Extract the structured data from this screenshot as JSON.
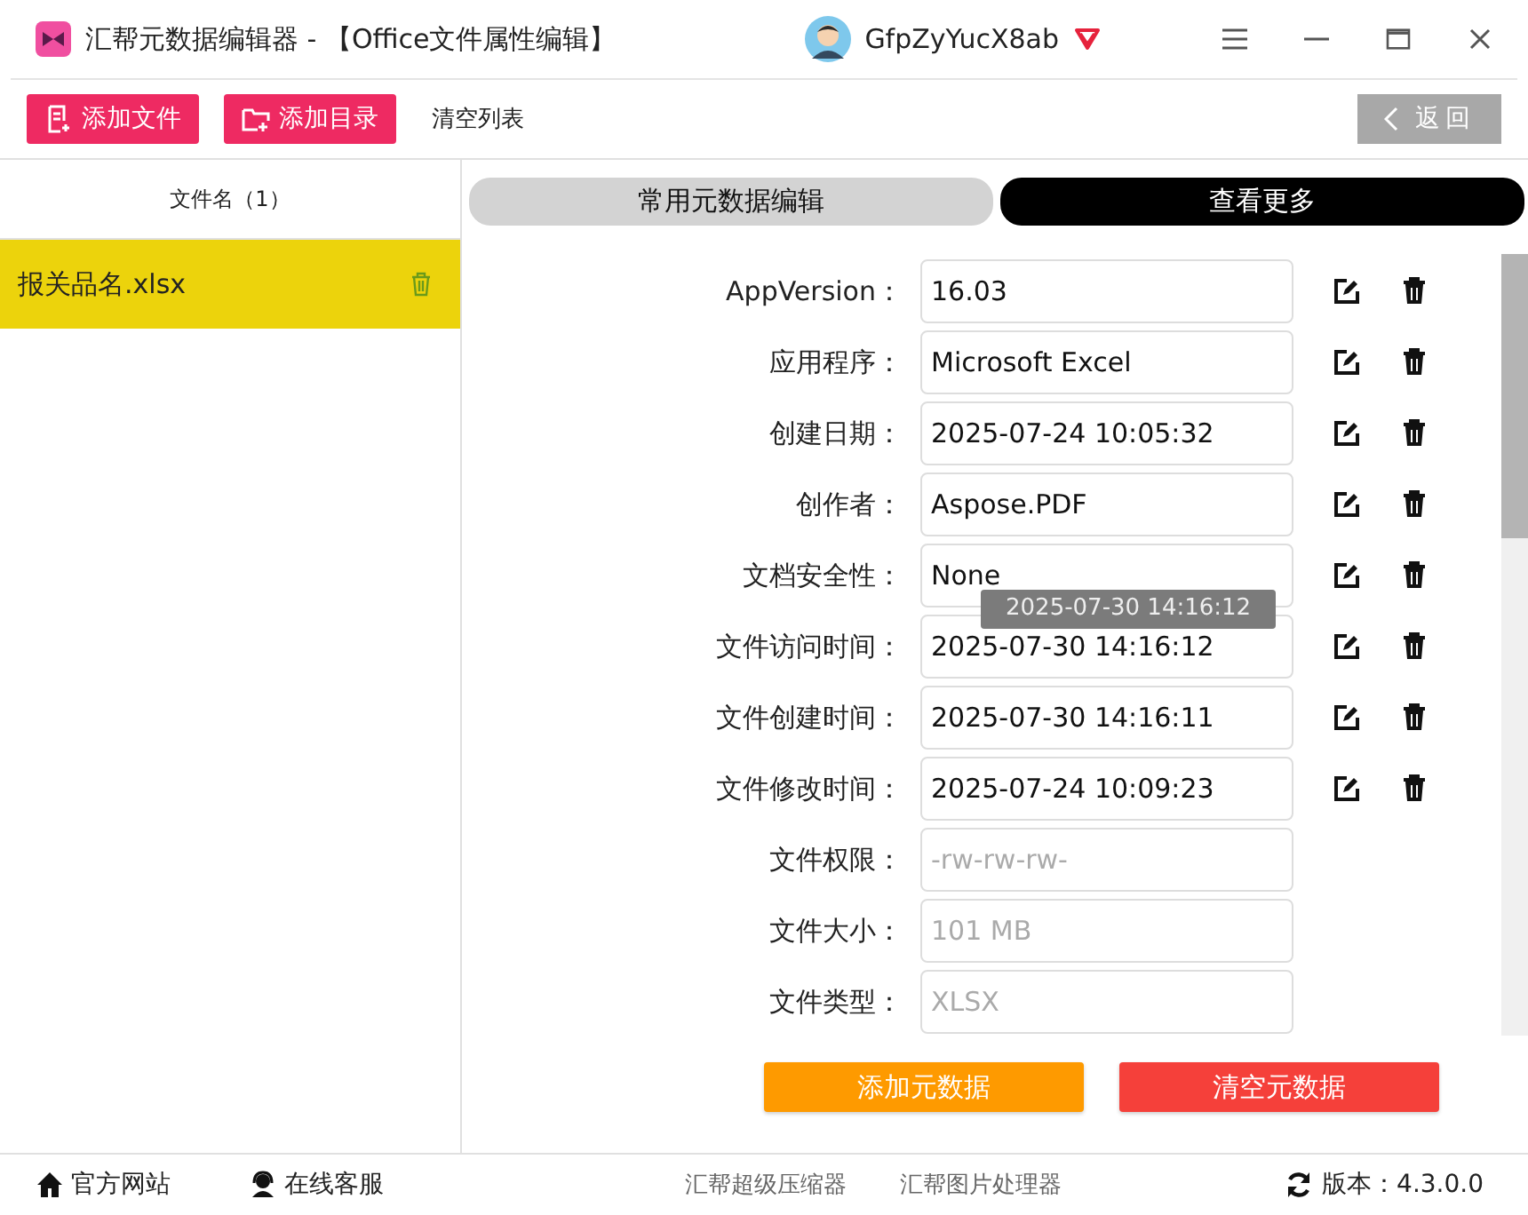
{
  "window": {
    "title": "汇帮元数据编辑器 - 【Office文件属性编辑】",
    "user": "GfpZyYucX8ab"
  },
  "toolbar": {
    "buttons": [
      {
        "label": "添加文件",
        "kind": "file"
      },
      {
        "label": "添加目录",
        "kind": "folder"
      }
    ],
    "clear": "清空列表",
    "back": "返回"
  },
  "file_list": {
    "header": "文件名（1）",
    "items": [
      {
        "name": "报关品名.xlsx",
        "selected": true
      }
    ]
  },
  "tabs": [
    {
      "label": "常用元数据编辑",
      "selected": true
    },
    {
      "label": "查看更多",
      "selected": false
    }
  ],
  "fields": [
    {
      "label": "AppVersion：",
      "value": "16.03",
      "readonly": false
    },
    {
      "label": "应用程序：",
      "value": "Microsoft Excel",
      "readonly": false
    },
    {
      "label": "创建日期：",
      "value": "2025-07-24 10:05:32",
      "readonly": false
    },
    {
      "label": "创作者：",
      "value": "Aspose.PDF",
      "readonly": false
    },
    {
      "label": "文档安全性：",
      "value": "None",
      "readonly": false
    },
    {
      "label": "文件访问时间：",
      "value": "2025-07-30 14:16:12",
      "readonly": false
    },
    {
      "label": "文件创建时间：",
      "value": "2025-07-30 14:16:11",
      "readonly": false
    },
    {
      "label": "文件修改时间：",
      "value": "2025-07-24 10:09:23",
      "readonly": false
    },
    {
      "label": "文件权限：",
      "value": "-rw-rw-rw-",
      "readonly": true
    },
    {
      "label": "文件大小：",
      "value": "101 MB",
      "readonly": true
    },
    {
      "label": "文件类型：",
      "value": "XLSX",
      "readonly": true
    }
  ],
  "tooltip": "2025-07-30 14:16:12",
  "actions": {
    "add": "添加元数据",
    "clear": "清空元数据"
  },
  "footer": {
    "links": [
      "官方网站",
      "在线客服"
    ],
    "apps": [
      "汇帮超级压缩器",
      "汇帮图片处理器"
    ],
    "version": "版本：4.3.0.0"
  }
}
